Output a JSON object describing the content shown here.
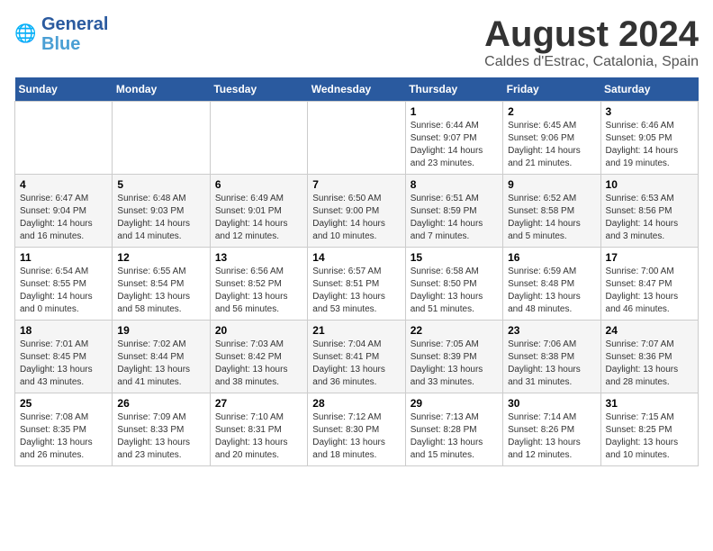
{
  "header": {
    "logo_line1": "General",
    "logo_line2": "Blue",
    "month": "August 2024",
    "location": "Caldes d'Estrac, Catalonia, Spain"
  },
  "weekdays": [
    "Sunday",
    "Monday",
    "Tuesday",
    "Wednesday",
    "Thursday",
    "Friday",
    "Saturday"
  ],
  "weeks": [
    [
      {
        "day": "",
        "sunrise": "",
        "sunset": "",
        "daylight": ""
      },
      {
        "day": "",
        "sunrise": "",
        "sunset": "",
        "daylight": ""
      },
      {
        "day": "",
        "sunrise": "",
        "sunset": "",
        "daylight": ""
      },
      {
        "day": "",
        "sunrise": "",
        "sunset": "",
        "daylight": ""
      },
      {
        "day": "1",
        "sunrise": "6:44 AM",
        "sunset": "9:07 PM",
        "daylight": "14 hours and 23 minutes."
      },
      {
        "day": "2",
        "sunrise": "6:45 AM",
        "sunset": "9:06 PM",
        "daylight": "14 hours and 21 minutes."
      },
      {
        "day": "3",
        "sunrise": "6:46 AM",
        "sunset": "9:05 PM",
        "daylight": "14 hours and 19 minutes."
      }
    ],
    [
      {
        "day": "4",
        "sunrise": "6:47 AM",
        "sunset": "9:04 PM",
        "daylight": "14 hours and 16 minutes."
      },
      {
        "day": "5",
        "sunrise": "6:48 AM",
        "sunset": "9:03 PM",
        "daylight": "14 hours and 14 minutes."
      },
      {
        "day": "6",
        "sunrise": "6:49 AM",
        "sunset": "9:01 PM",
        "daylight": "14 hours and 12 minutes."
      },
      {
        "day": "7",
        "sunrise": "6:50 AM",
        "sunset": "9:00 PM",
        "daylight": "14 hours and 10 minutes."
      },
      {
        "day": "8",
        "sunrise": "6:51 AM",
        "sunset": "8:59 PM",
        "daylight": "14 hours and 7 minutes."
      },
      {
        "day": "9",
        "sunrise": "6:52 AM",
        "sunset": "8:58 PM",
        "daylight": "14 hours and 5 minutes."
      },
      {
        "day": "10",
        "sunrise": "6:53 AM",
        "sunset": "8:56 PM",
        "daylight": "14 hours and 3 minutes."
      }
    ],
    [
      {
        "day": "11",
        "sunrise": "6:54 AM",
        "sunset": "8:55 PM",
        "daylight": "14 hours and 0 minutes."
      },
      {
        "day": "12",
        "sunrise": "6:55 AM",
        "sunset": "8:54 PM",
        "daylight": "13 hours and 58 minutes."
      },
      {
        "day": "13",
        "sunrise": "6:56 AM",
        "sunset": "8:52 PM",
        "daylight": "13 hours and 56 minutes."
      },
      {
        "day": "14",
        "sunrise": "6:57 AM",
        "sunset": "8:51 PM",
        "daylight": "13 hours and 53 minutes."
      },
      {
        "day": "15",
        "sunrise": "6:58 AM",
        "sunset": "8:50 PM",
        "daylight": "13 hours and 51 minutes."
      },
      {
        "day": "16",
        "sunrise": "6:59 AM",
        "sunset": "8:48 PM",
        "daylight": "13 hours and 48 minutes."
      },
      {
        "day": "17",
        "sunrise": "7:00 AM",
        "sunset": "8:47 PM",
        "daylight": "13 hours and 46 minutes."
      }
    ],
    [
      {
        "day": "18",
        "sunrise": "7:01 AM",
        "sunset": "8:45 PM",
        "daylight": "13 hours and 43 minutes."
      },
      {
        "day": "19",
        "sunrise": "7:02 AM",
        "sunset": "8:44 PM",
        "daylight": "13 hours and 41 minutes."
      },
      {
        "day": "20",
        "sunrise": "7:03 AM",
        "sunset": "8:42 PM",
        "daylight": "13 hours and 38 minutes."
      },
      {
        "day": "21",
        "sunrise": "7:04 AM",
        "sunset": "8:41 PM",
        "daylight": "13 hours and 36 minutes."
      },
      {
        "day": "22",
        "sunrise": "7:05 AM",
        "sunset": "8:39 PM",
        "daylight": "13 hours and 33 minutes."
      },
      {
        "day": "23",
        "sunrise": "7:06 AM",
        "sunset": "8:38 PM",
        "daylight": "13 hours and 31 minutes."
      },
      {
        "day": "24",
        "sunrise": "7:07 AM",
        "sunset": "8:36 PM",
        "daylight": "13 hours and 28 minutes."
      }
    ],
    [
      {
        "day": "25",
        "sunrise": "7:08 AM",
        "sunset": "8:35 PM",
        "daylight": "13 hours and 26 minutes."
      },
      {
        "day": "26",
        "sunrise": "7:09 AM",
        "sunset": "8:33 PM",
        "daylight": "13 hours and 23 minutes."
      },
      {
        "day": "27",
        "sunrise": "7:10 AM",
        "sunset": "8:31 PM",
        "daylight": "13 hours and 20 minutes."
      },
      {
        "day": "28",
        "sunrise": "7:12 AM",
        "sunset": "8:30 PM",
        "daylight": "13 hours and 18 minutes."
      },
      {
        "day": "29",
        "sunrise": "7:13 AM",
        "sunset": "8:28 PM",
        "daylight": "13 hours and 15 minutes."
      },
      {
        "day": "30",
        "sunrise": "7:14 AM",
        "sunset": "8:26 PM",
        "daylight": "13 hours and 12 minutes."
      },
      {
        "day": "31",
        "sunrise": "7:15 AM",
        "sunset": "8:25 PM",
        "daylight": "13 hours and 10 minutes."
      }
    ]
  ]
}
